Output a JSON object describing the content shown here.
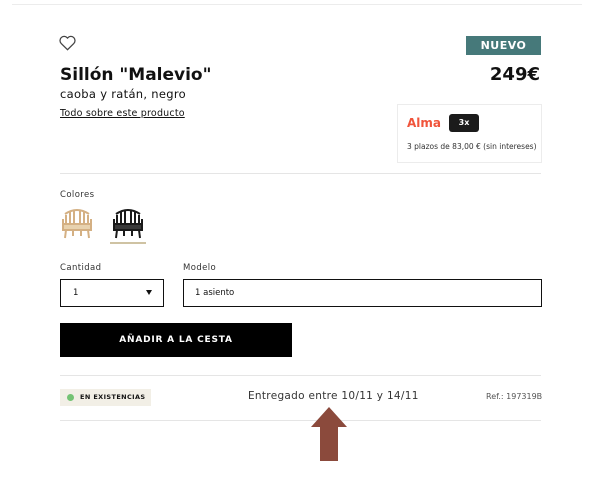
{
  "product": {
    "badge": "NUEVO",
    "title": "Sillón \"Malevio\"",
    "price": "249€",
    "subtitle": "caoba y ratán, negro",
    "details_link": "Todo sobre este producto"
  },
  "alma": {
    "logo": "Alma",
    "installments_tag": "3x",
    "text": "3 plazos de 83,00 € (sin intereses)",
    "brand_color": "#f0543b"
  },
  "colors": {
    "label": "Colores",
    "swatches": [
      {
        "name": "natural",
        "color": "#d9b98a",
        "selected": false
      },
      {
        "name": "negro",
        "color": "#1a1a1a",
        "selected": true
      }
    ]
  },
  "quantity": {
    "label": "Cantidad",
    "value": "1"
  },
  "model": {
    "label": "Modelo",
    "value": "1 asiento"
  },
  "cart": {
    "button_label": "AÑADIR A LA CESTA"
  },
  "stock": {
    "label": "EN EXISTENCIAS",
    "status_color": "#74c374"
  },
  "delivery": {
    "text": "Entregado entre 10/11 y 14/11"
  },
  "ref": {
    "text": "Ref.: 197319B"
  },
  "accent": {
    "badge_color": "#46797a",
    "annotation_arrow_color": "#8b4a3c"
  }
}
